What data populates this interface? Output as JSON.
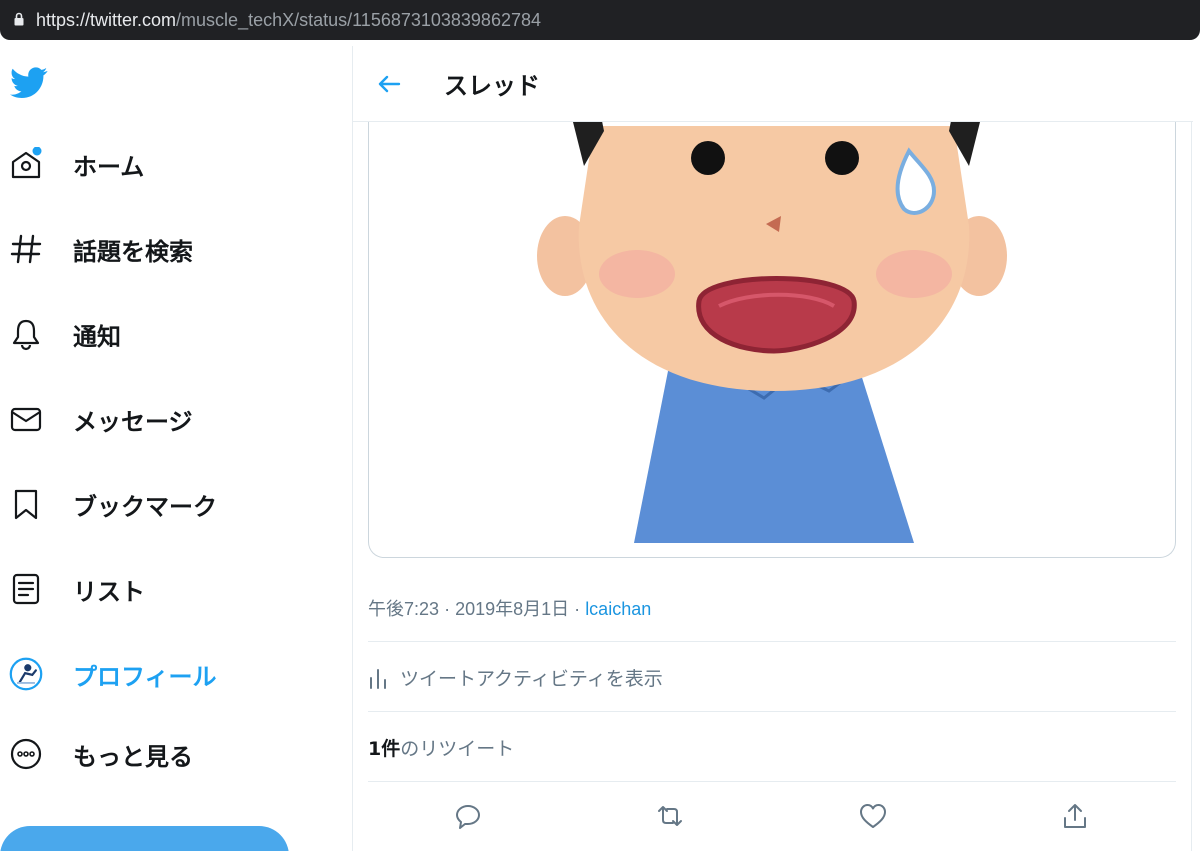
{
  "browser": {
    "url_host": "https://twitter.com",
    "url_path": "/muscle_techX/status/1156873103839862784"
  },
  "sidebar": {
    "items": [
      {
        "label": "ホーム",
        "icon": "home-icon"
      },
      {
        "label": "話題を検索",
        "icon": "hashtag-icon"
      },
      {
        "label": "通知",
        "icon": "bell-icon"
      },
      {
        "label": "メッセージ",
        "icon": "envelope-icon"
      },
      {
        "label": "ブックマーク",
        "icon": "bookmark-icon"
      },
      {
        "label": "リスト",
        "icon": "list-icon"
      },
      {
        "label": "プロフィール",
        "icon": "avatar-icon",
        "active": true
      },
      {
        "label": "もっと見る",
        "icon": "more-icon"
      }
    ]
  },
  "header": {
    "title": "スレッド"
  },
  "tweet": {
    "time": "午後7:23",
    "sep": "·",
    "date": "2019年8月1日",
    "source": "lcaichan",
    "activity_label": "ツイートアクティビティを表示",
    "retweet_count": "1件",
    "retweet_label": "のリツイート"
  },
  "colors": {
    "accent": "#1da1f2",
    "notification_dot": "#1da1f2",
    "shirt": "#5b8ed6",
    "skin": "#f6c9a4",
    "mouth": "#b83a4a"
  }
}
